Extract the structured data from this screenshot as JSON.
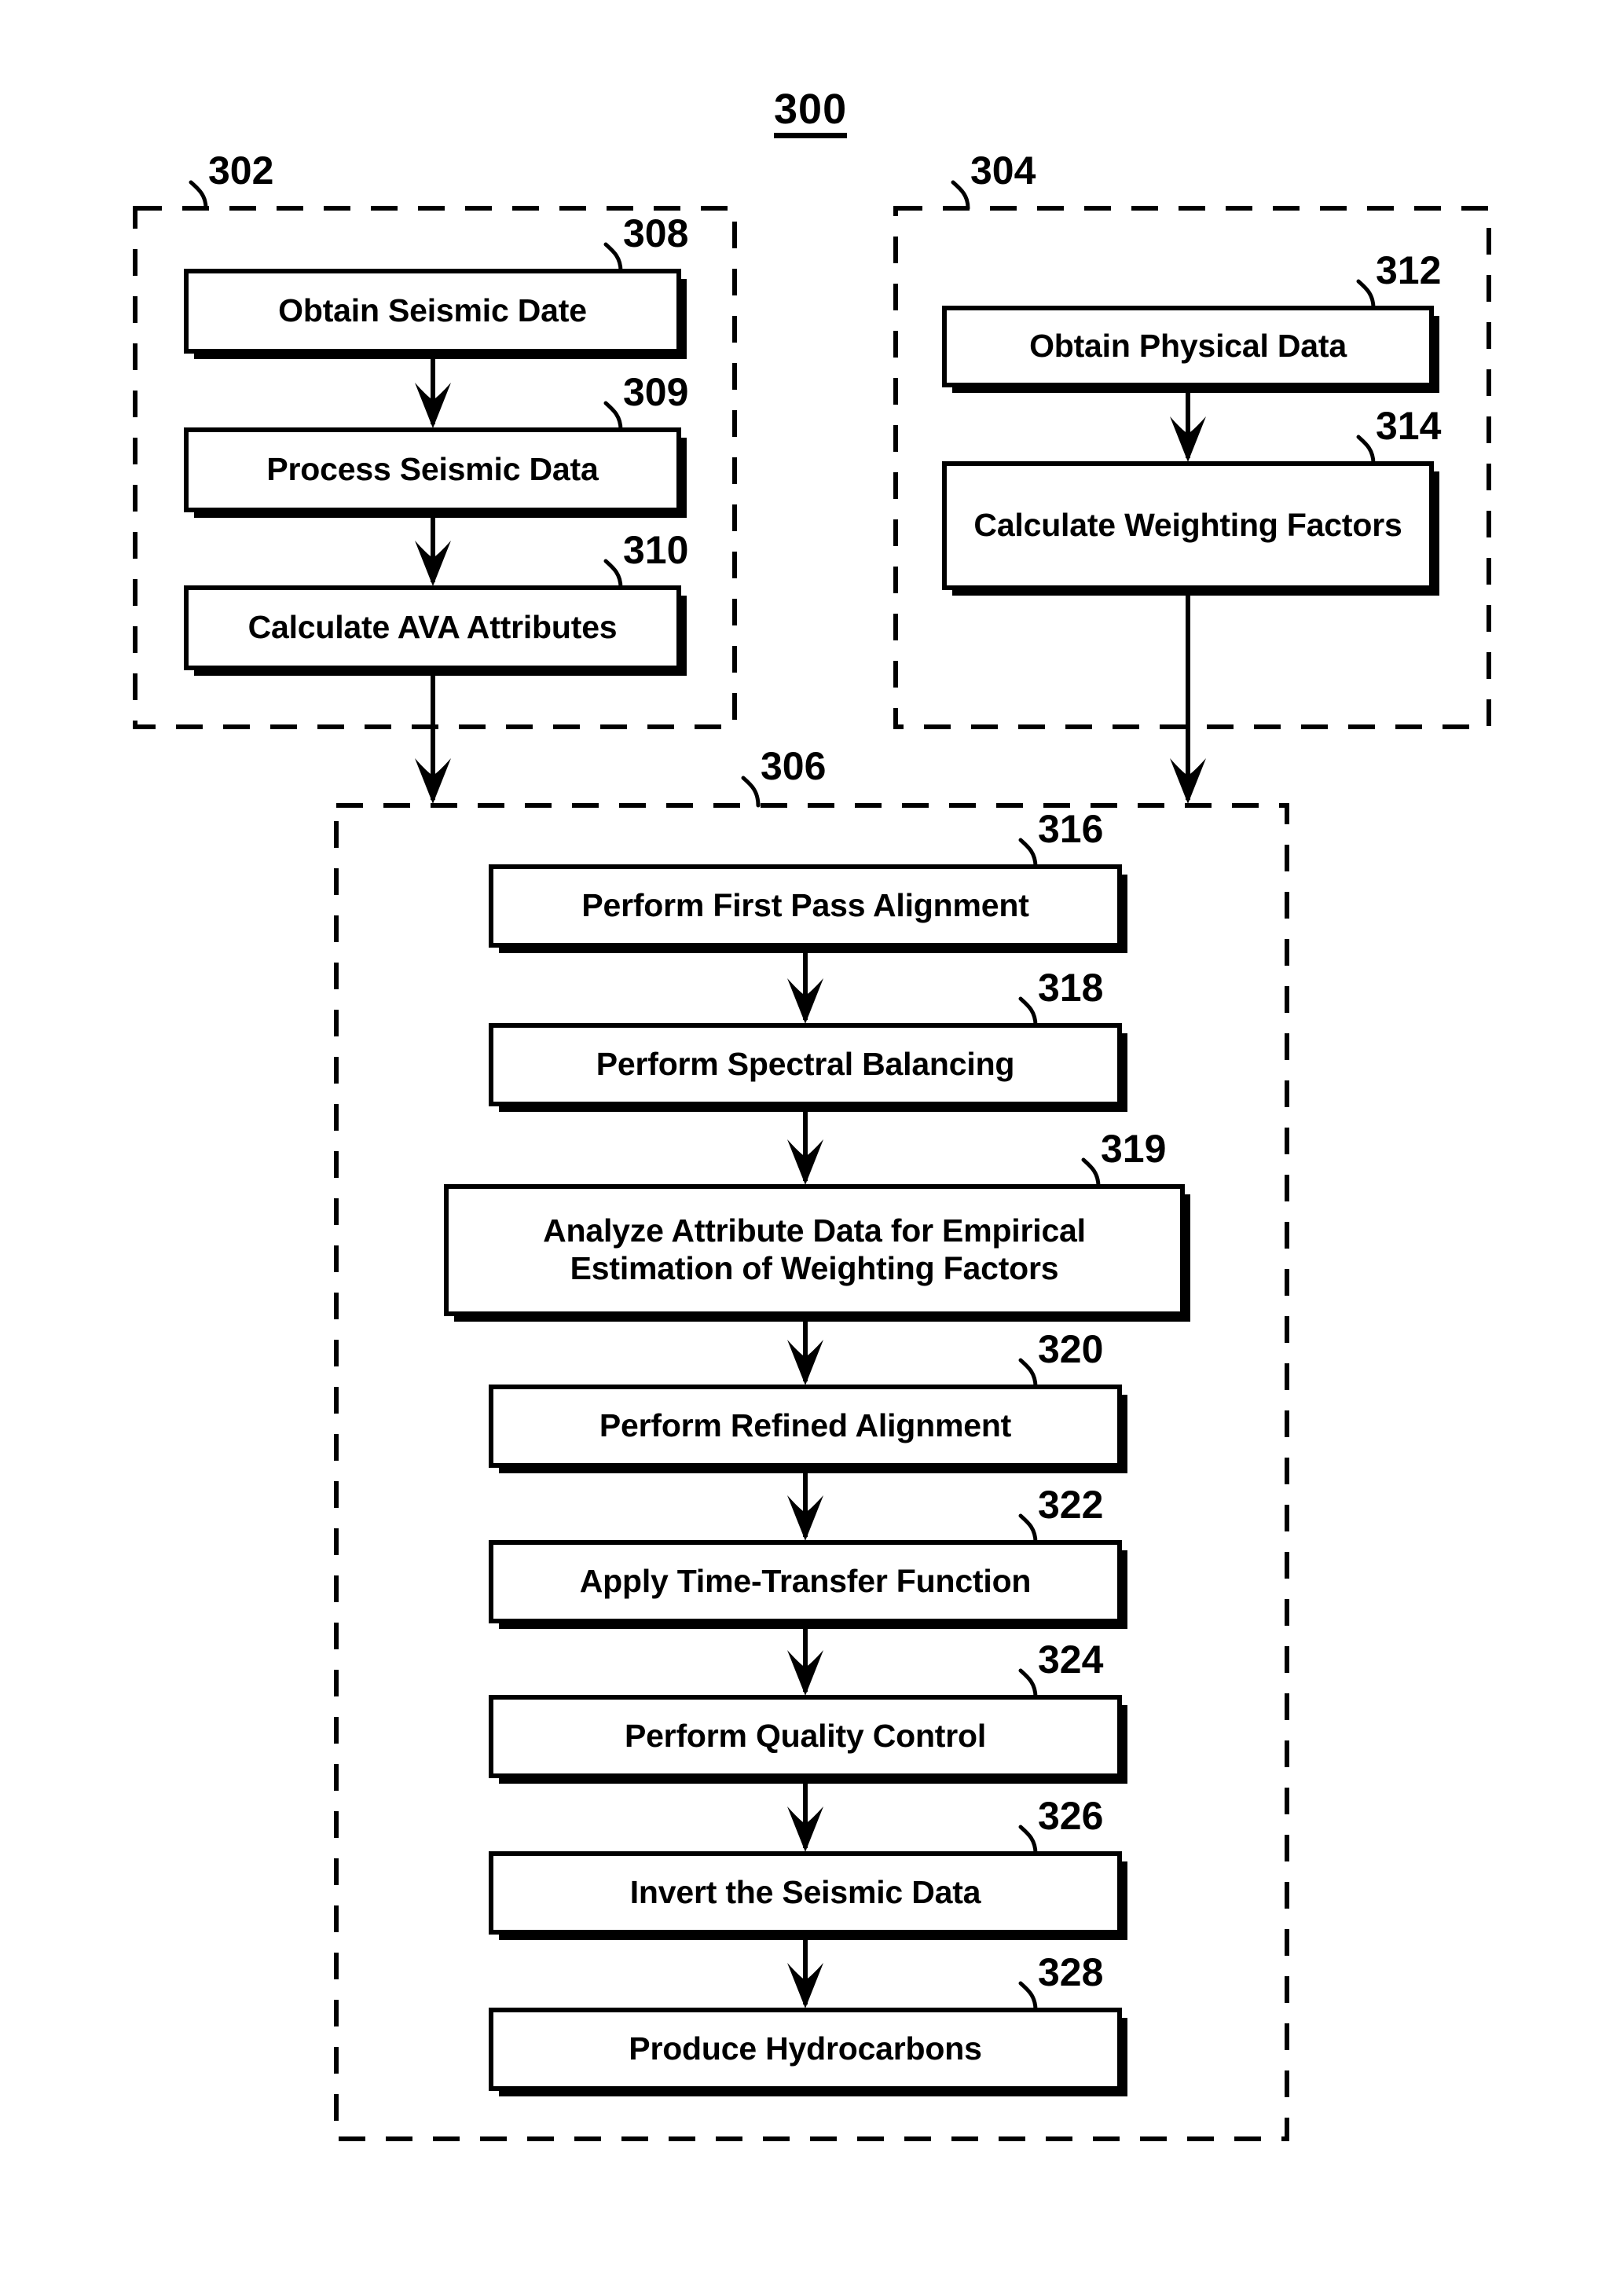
{
  "figure": {
    "number": "300",
    "type": "patent-flowchart"
  },
  "groups": [
    {
      "id": "302",
      "label": "302",
      "role": "seismic-data-branch"
    },
    {
      "id": "304",
      "label": "304",
      "role": "physical-data-branch"
    },
    {
      "id": "306",
      "label": "306",
      "role": "main-processing-branch"
    }
  ],
  "steps": [
    {
      "ref": "308",
      "text": "Obtain Seismic Date",
      "group": "302"
    },
    {
      "ref": "309",
      "text": "Process Seismic Data",
      "group": "302"
    },
    {
      "ref": "310",
      "text": "Calculate AVA Attributes",
      "group": "302"
    },
    {
      "ref": "312",
      "text": "Obtain Physical Data",
      "group": "304"
    },
    {
      "ref": "314",
      "text": "Calculate Weighting Factors",
      "group": "304"
    },
    {
      "ref": "316",
      "text": "Perform First Pass Alignment",
      "group": "306"
    },
    {
      "ref": "318",
      "text": "Perform Spectral Balancing",
      "group": "306"
    },
    {
      "ref": "319",
      "text": "Analyze Attribute Data for Empirical Estimation of Weighting Factors",
      "group": "306"
    },
    {
      "ref": "320",
      "text": "Perform Refined Alignment",
      "group": "306"
    },
    {
      "ref": "322",
      "text": "Apply Time-Transfer Function",
      "group": "306"
    },
    {
      "ref": "324",
      "text": "Perform Quality Control",
      "group": "306"
    },
    {
      "ref": "326",
      "text": "Invert the Seismic Data",
      "group": "306"
    },
    {
      "ref": "328",
      "text": "Produce Hydrocarbons",
      "group": "306"
    }
  ],
  "colors": {
    "ink": "#000000",
    "paper": "#ffffff"
  }
}
